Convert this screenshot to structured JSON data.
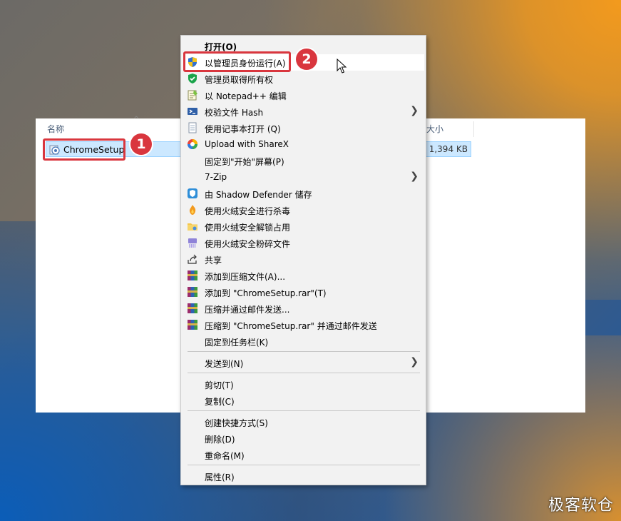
{
  "explorer": {
    "columns": {
      "name": "名称",
      "size": "大小"
    },
    "file": {
      "name": "ChromeSetup",
      "size": "1,394 KB"
    }
  },
  "annotations": {
    "badge1": "1",
    "badge2": "2"
  },
  "menu": {
    "items": [
      {
        "label": "打开(O)",
        "icon": "none"
      },
      {
        "label": "以管理员身份运行(A)",
        "icon": "uac-shield-icon"
      },
      {
        "label": "管理员取得所有权",
        "icon": "green-shield-icon"
      },
      {
        "label": "以 Notepad++ 编辑",
        "icon": "notepad-plus-icon"
      },
      {
        "label": "校验文件 Hash",
        "icon": "powershell-icon"
      },
      {
        "label": "使用记事本打开 (Q)",
        "icon": "notepad-icon"
      },
      {
        "label": "Upload with ShareX",
        "icon": "sharex-icon"
      },
      {
        "label": "固定到\"开始\"屏幕(P)",
        "icon": "none"
      },
      {
        "label": "7-Zip",
        "icon": "none"
      },
      {
        "label": "由 Shadow Defender 储存",
        "icon": "shadow-defender-icon"
      },
      {
        "label": "使用火绒安全进行杀毒",
        "icon": "huorong-icon"
      },
      {
        "label": "使用火绒安全解锁占用",
        "icon": "huorong-folder-icon"
      },
      {
        "label": "使用火绒安全粉碎文件",
        "icon": "huorong-shred-icon"
      },
      {
        "label": "共享",
        "icon": "share-icon"
      },
      {
        "label": "添加到压缩文件(A)...",
        "icon": "winrar-icon"
      },
      {
        "label": "添加到 \"ChromeSetup.rar\"(T)",
        "icon": "winrar-icon"
      },
      {
        "label": "压缩并通过邮件发送...",
        "icon": "winrar-icon"
      },
      {
        "label": "压缩到 \"ChromeSetup.rar\" 并通过邮件发送",
        "icon": "winrar-icon"
      },
      {
        "label": "固定到任务栏(K)",
        "icon": "none"
      },
      {
        "label": "发送到(N)",
        "icon": "none"
      },
      {
        "label": "剪切(T)",
        "icon": "none"
      },
      {
        "label": "复制(C)",
        "icon": "none"
      },
      {
        "label": "创建快捷方式(S)",
        "icon": "none"
      },
      {
        "label": "删除(D)",
        "icon": "none"
      },
      {
        "label": "重命名(M)",
        "icon": "none"
      },
      {
        "label": "属性(R)",
        "icon": "none"
      }
    ]
  },
  "watermark": "极客软仓",
  "colors": {
    "highlight": "#d9363e",
    "selection": "#cce8ff"
  }
}
